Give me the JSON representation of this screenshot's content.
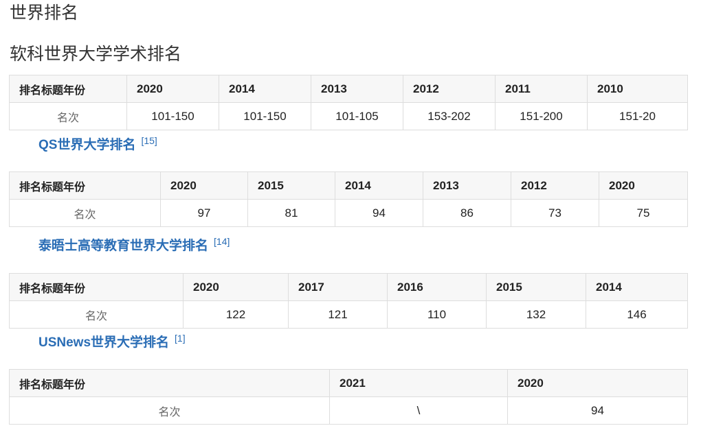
{
  "page": {
    "heading": "世界排名",
    "subheading": "软科世界大学学术排名"
  },
  "tables": [
    {
      "header_label": "排名标题年份",
      "row_label": "名次",
      "years": [
        "2020",
        "2014",
        "2013",
        "2012",
        "2011",
        "2010"
      ],
      "values": [
        "101-150",
        "101-150",
        "101-105",
        "153-202",
        "151-200",
        "151-20"
      ]
    },
    {
      "caption_latin": "QS",
      "caption_cjk": "世界大学排名",
      "ref": "[15]",
      "header_label": "排名标题年份",
      "row_label": "名次",
      "years": [
        "2020",
        "2015",
        "2014",
        "2013",
        "2012",
        "2020"
      ],
      "values": [
        "97",
        "81",
        "94",
        "86",
        "73",
        "75"
      ]
    },
    {
      "caption_latin": "",
      "caption_cjk": "泰晤士高等教育世界大学排名",
      "ref": "[14]",
      "header_label": "排名标题年份",
      "row_label": "名次",
      "years": [
        "2020",
        "2017",
        "2016",
        "2015",
        "2014"
      ],
      "values": [
        "122",
        "121",
        "110",
        "132",
        "146"
      ]
    },
    {
      "caption_latin": "USNews",
      "caption_cjk": "世界大学排名",
      "ref": "[1]",
      "header_label": "排名标题年份",
      "row_label": "名次",
      "years": [
        "2021",
        "2020"
      ],
      "values": [
        "\\",
        "94"
      ]
    }
  ]
}
